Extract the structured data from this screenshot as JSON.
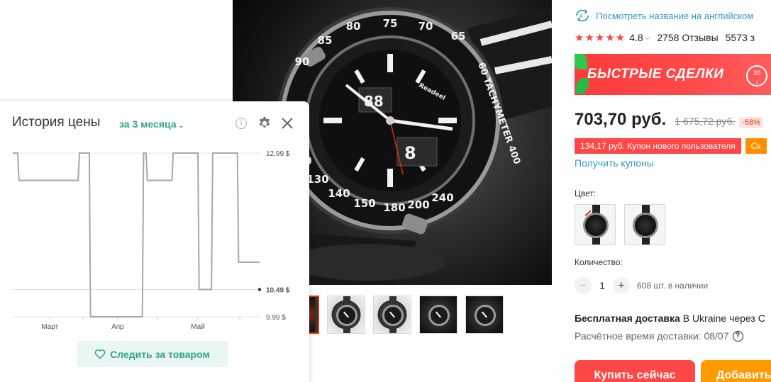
{
  "product": {
    "translate_link": "Посмотреть название на английском",
    "rating": "4.8",
    "reviews": "2758 Отзывы",
    "orders": "5573 з",
    "deals_banner": "БЫСТРЫЕ СДЕЛКИ",
    "deals_timer": "30",
    "price": "703,70 руб.",
    "old_price": "1 675,72 руб.",
    "discount": "-58%",
    "coupons": [
      "134,17 руб. Купон нового пользователя",
      "Ск"
    ],
    "get_coupons": "Получить купоны",
    "color_label": "Цвет:",
    "quantity_label": "Количество:",
    "quantity": "1",
    "stock": "608 шт. в наличии",
    "shipping_bold": "Бесплатная доставка",
    "shipping_rest": " В Ukraine через С",
    "eta": "Расчётное время доставки: 08/07",
    "buy_now": "Купить сейчас",
    "add_to_cart": "Добавить",
    "colors": {
      "accent": "#ff4747",
      "link": "#2e9cc6",
      "star": "#f0494a",
      "add_button": "#ff9a00"
    }
  },
  "price_history": {
    "title": "История цены",
    "period": "за 3 месяца",
    "follow_button": "Следить за товаром",
    "accent": "#31a58a"
  },
  "chart_data": {
    "type": "line",
    "title": "История цены",
    "ylabel": "",
    "xlabel": "",
    "ylim": [
      9.99,
      12.99
    ],
    "y_ticks": [
      "12.99 $",
      "10.49 $",
      "9.99 $"
    ],
    "x_ticks": [
      "Март",
      "Апр",
      "Май"
    ],
    "current_label": "10.49 $",
    "grid": true,
    "x": [
      0,
      2,
      2.5,
      26.5,
      27,
      31,
      31.5,
      52.5,
      53,
      54,
      54.5,
      64.5,
      65,
      75,
      75.5,
      80.5,
      81,
      91,
      91.5,
      100
    ],
    "values": [
      12.99,
      12.99,
      12.49,
      12.49,
      12.99,
      12.99,
      9.99,
      9.99,
      12.99,
      12.99,
      12.49,
      12.49,
      12.99,
      12.99,
      10.49,
      10.49,
      12.99,
      12.99,
      10.99,
      10.99
    ]
  }
}
